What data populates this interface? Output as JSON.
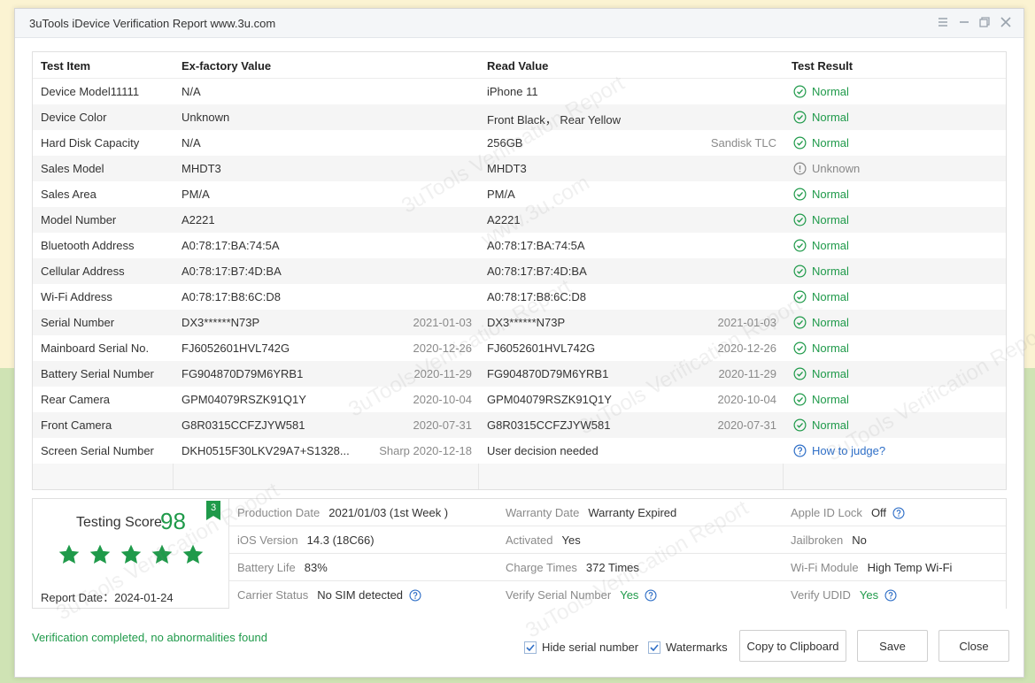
{
  "window": {
    "title": "3uTools iDevice Verification Report www.3u.com"
  },
  "table": {
    "headers": [
      "Test Item",
      "Ex-factory Value",
      "Read Value",
      "Test Result"
    ],
    "rows": [
      {
        "item": "Device Model11111",
        "ex": "N/A",
        "ex_sub": "",
        "read": "iPhone 11",
        "read_sub": "",
        "result": "Normal",
        "status": "normal"
      },
      {
        "item": "Device Color",
        "ex": "Unknown",
        "ex_sub": "",
        "read": "Front Black， Rear Yellow",
        "read_sub": "",
        "result": "Normal",
        "status": "normal"
      },
      {
        "item": "Hard Disk Capacity",
        "ex": "N/A",
        "ex_sub": "",
        "read": "256GB",
        "read_sub": "Sandisk TLC",
        "result": "Normal",
        "status": "normal"
      },
      {
        "item": "Sales Model",
        "ex": "MHDT3",
        "ex_sub": "",
        "read": "MHDT3",
        "read_sub": "",
        "result": "Unknown",
        "status": "unknown"
      },
      {
        "item": "Sales Area",
        "ex": "PM/A",
        "ex_sub": "",
        "read": "PM/A",
        "read_sub": "",
        "result": "Normal",
        "status": "normal"
      },
      {
        "item": "Model Number",
        "ex": "A2221",
        "ex_sub": "",
        "read": "A2221",
        "read_sub": "",
        "result": "Normal",
        "status": "normal"
      },
      {
        "item": "Bluetooth Address",
        "ex": "A0:78:17:BA:74:5A",
        "ex_sub": "",
        "read": "A0:78:17:BA:74:5A",
        "read_sub": "",
        "result": "Normal",
        "status": "normal"
      },
      {
        "item": "Cellular Address",
        "ex": "A0:78:17:B7:4D:BA",
        "ex_sub": "",
        "read": "A0:78:17:B7:4D:BA",
        "read_sub": "",
        "result": "Normal",
        "status": "normal"
      },
      {
        "item": "Wi-Fi Address",
        "ex": "A0:78:17:B8:6C:D8",
        "ex_sub": "",
        "read": "A0:78:17:B8:6C:D8",
        "read_sub": "",
        "result": "Normal",
        "status": "normal"
      },
      {
        "item": "Serial Number",
        "ex": "DX3******N73P",
        "ex_sub": "2021-01-03",
        "read": "DX3******N73P",
        "read_sub": "2021-01-03",
        "result": "Normal",
        "status": "normal"
      },
      {
        "item": "Mainboard Serial No.",
        "ex": "FJ6052601HVL742G",
        "ex_sub": "2020-12-26",
        "read": "FJ6052601HVL742G",
        "read_sub": "2020-12-26",
        "result": "Normal",
        "status": "normal"
      },
      {
        "item": "Battery Serial Number",
        "ex": "FG904870D79M6YRB1",
        "ex_sub": "2020-11-29",
        "read": "FG904870D79M6YRB1",
        "read_sub": "2020-11-29",
        "result": "Normal",
        "status": "normal"
      },
      {
        "item": "Rear Camera",
        "ex": "GPM04079RSZK91Q1Y",
        "ex_sub": "2020-10-04",
        "read": "GPM04079RSZK91Q1Y",
        "read_sub": "2020-10-04",
        "result": "Normal",
        "status": "normal"
      },
      {
        "item": "Front Camera",
        "ex": "G8R0315CCFZJYW581",
        "ex_sub": "2020-07-31",
        "read": "G8R0315CCFZJYW581",
        "read_sub": "2020-07-31",
        "result": "Normal",
        "status": "normal"
      },
      {
        "item": "Screen Serial Number",
        "ex": "DKH0515F30LKV29A7+S1328...",
        "ex_sub": "Sharp 2020-12-18",
        "read": "User decision needed",
        "read_sub": "",
        "result": "How to judge?",
        "status": "judge"
      }
    ]
  },
  "score": {
    "label": "Testing Score",
    "value": "98",
    "badge": "3",
    "stars": 5
  },
  "report_date": "Report Date：2024-01-24",
  "summary": [
    [
      {
        "k": "Production Date",
        "v": "2021/01/03 (1st Week )",
        "help": false,
        "green": false
      },
      {
        "k": "Warranty Date",
        "v": "Warranty Expired",
        "help": false,
        "green": false
      },
      {
        "k": "Apple ID Lock",
        "v": "Off",
        "help": true,
        "green": false
      }
    ],
    [
      {
        "k": "iOS Version",
        "v": "14.3 (18C66)",
        "help": false,
        "green": false
      },
      {
        "k": "Activated",
        "v": "Yes",
        "help": false,
        "green": false
      },
      {
        "k": "Jailbroken",
        "v": "No",
        "help": false,
        "green": false
      }
    ],
    [
      {
        "k": "Battery Life",
        "v": "83%",
        "help": false,
        "green": false
      },
      {
        "k": "Charge Times",
        "v": "372 Times",
        "help": false,
        "green": false
      },
      {
        "k": "Wi-Fi Module",
        "v": "High Temp Wi-Fi",
        "help": false,
        "green": false
      }
    ],
    [
      {
        "k": "Carrier Status",
        "v": "No SIM detected",
        "help": true,
        "green": false
      },
      {
        "k": "Verify Serial Number",
        "v": "Yes",
        "help": true,
        "green": true
      },
      {
        "k": "Verify UDID",
        "v": "Yes",
        "help": true,
        "green": true
      }
    ]
  ],
  "footer": {
    "status": "Verification completed, no abnormalities found",
    "hide_serial": "Hide serial number",
    "watermarks": "Watermarks",
    "copy": "Copy to Clipboard",
    "save": "Save",
    "close": "Close"
  },
  "watermark_text": [
    "3uTools Verification Report",
    "www.3u.com"
  ],
  "colors": {
    "green": "#1f9a4a",
    "link": "#2f6fc7",
    "muted": "#8a8a8a"
  }
}
